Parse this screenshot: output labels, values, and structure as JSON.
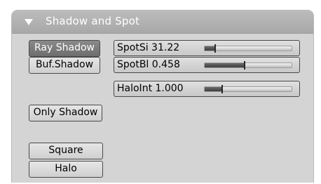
{
  "panel": {
    "title": "Shadow and Spot"
  },
  "buttons": {
    "ray_shadow": "Ray Shadow",
    "buf_shadow": "Buf.Shadow",
    "only_shadow": "Only Shadow",
    "square": "Square",
    "halo": "Halo"
  },
  "sliders": [
    {
      "label": "SpotSi 31.22",
      "fraction": 0.12
    },
    {
      "label": "SpotBl 0.458",
      "fraction": 0.458
    },
    {
      "label": "HaloInt 1.000",
      "fraction": 0.2
    }
  ],
  "colors": {
    "panel_bg": "#d4d4d4",
    "header_bg": "#b0b0b0",
    "active_button": "#7a7a7a"
  }
}
